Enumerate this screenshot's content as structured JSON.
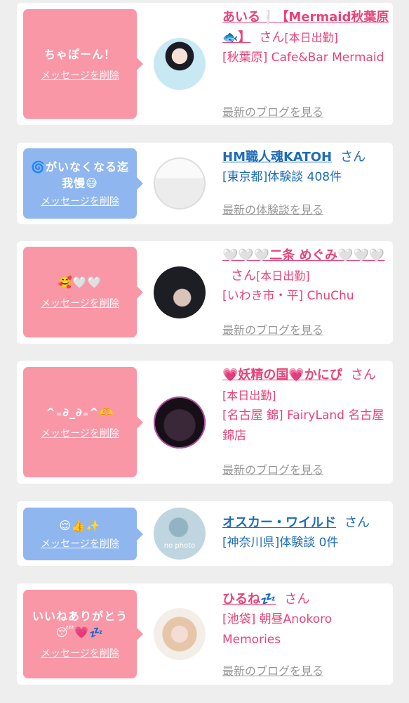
{
  "delete_label": "メッセージを削除",
  "honorific": "さん",
  "colors": {
    "pink_bubble": "#f997a7",
    "blue_bubble": "#8fb6ef",
    "pink_text": "#e84377",
    "blue_text": "#1f6cb8",
    "link_gray": "#999999"
  },
  "cards": [
    {
      "message": "ちゃぽーん！",
      "name": "あいる❕【Mermaid秋葉原🐟】",
      "status": "[本日出勤]",
      "location": "[秋葉原] Cafe&Bar Mermaid",
      "link": "最新のブログを見る"
    },
    {
      "message": "🌀がいなくなる迄我慢😅",
      "name": "HM職人魂KATOH",
      "location": "[東京都]体験談 408件",
      "link": "最新の体験談を見る"
    },
    {
      "message": "🥰🤍🤍",
      "name": "🤍🤍🤍二条 めぐみ🤍🤍🤍",
      "status": "[本日出勤]",
      "location": "[いわき市・平] ChuChu",
      "link": "最新のブログを見る"
    },
    {
      "message": "^₌∂_∂₌^🫶",
      "name": "💗妖精の国💗かにぴ",
      "status": "[本日出勤]",
      "location": "[名古屋 錦] FairyLand 名古屋錦店",
      "link": "最新のブログを見る"
    },
    {
      "message": "😌👍✨",
      "name": "オスカー・ワイルド",
      "location": "[神奈川県]体験談 0件",
      "avatar_text": "no photo"
    },
    {
      "message": "いいねありがとう😴💗💤",
      "name": "ひるね💤",
      "location": "[池袋] 朝昼Anokoro Memories",
      "link": "最新のブログを見る"
    }
  ]
}
